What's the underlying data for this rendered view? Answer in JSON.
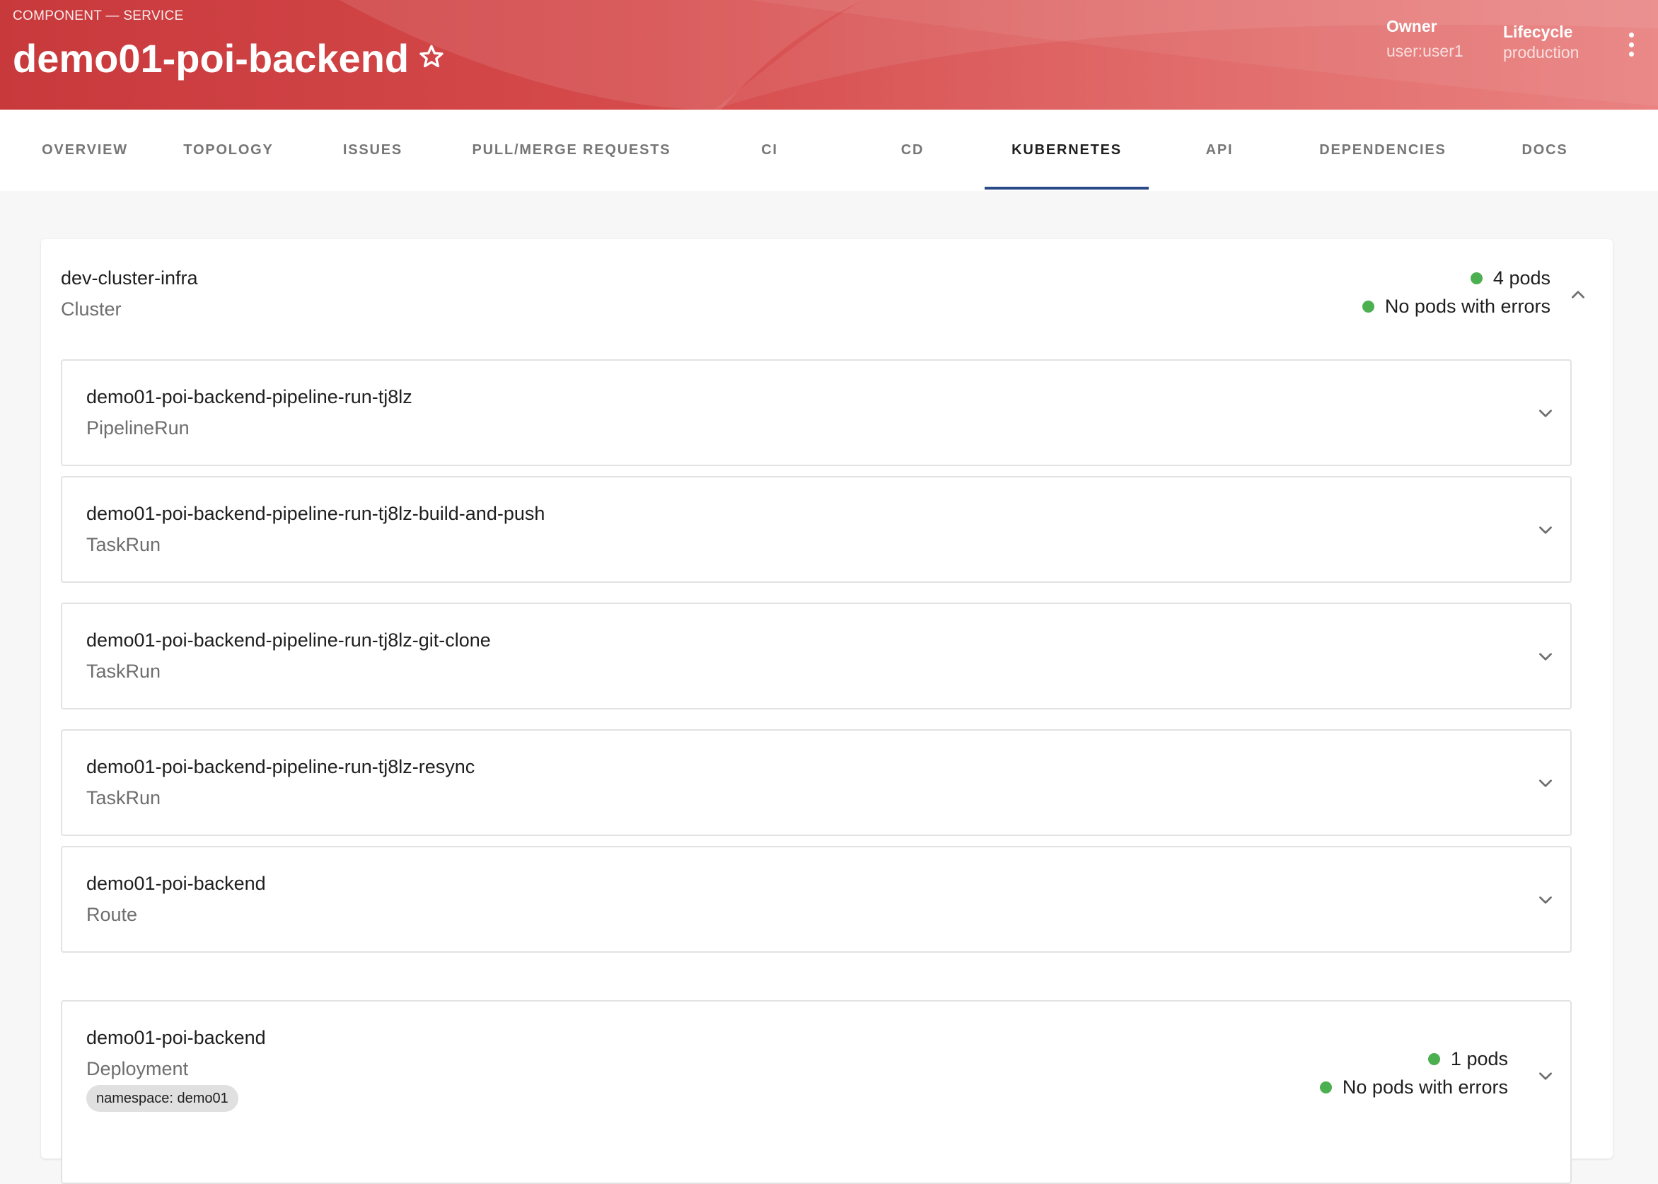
{
  "header": {
    "breadcrumb": "COMPONENT — SERVICE",
    "title": "demo01-poi-backend",
    "owner_label": "Owner",
    "owner_value": "user:user1",
    "lifecycle_label": "Lifecycle",
    "lifecycle_value": "production",
    "favorite_icon": "star-outline",
    "menu_icon": "more-vertical"
  },
  "tabs": [
    {
      "label": "OVERVIEW"
    },
    {
      "label": "TOPOLOGY"
    },
    {
      "label": "ISSUES"
    },
    {
      "label": "PULL/MERGE REQUESTS"
    },
    {
      "label": "CI"
    },
    {
      "label": "CD"
    },
    {
      "label": "KUBERNETES",
      "active": true
    },
    {
      "label": "API"
    },
    {
      "label": "DEPENDENCIES"
    },
    {
      "label": "DOCS"
    }
  ],
  "cluster": {
    "name": "dev-cluster-infra",
    "type": "Cluster",
    "pods": "4 pods",
    "errors": "No pods with errors",
    "expanded": true,
    "resources": [
      {
        "name": "demo01-poi-backend-pipeline-run-tj8lz",
        "kind": "PipelineRun"
      },
      {
        "name": "demo01-poi-backend-pipeline-run-tj8lz-build-and-push",
        "kind": "TaskRun"
      },
      {
        "name": "demo01-poi-backend-pipeline-run-tj8lz-git-clone",
        "kind": "TaskRun"
      },
      {
        "name": "demo01-poi-backend-pipeline-run-tj8lz-resync",
        "kind": "TaskRun"
      },
      {
        "name": "demo01-poi-backend",
        "kind": "Route"
      }
    ],
    "deployment": {
      "name": "demo01-poi-backend",
      "kind": "Deployment",
      "namespace_chip": "namespace: demo01",
      "pods": "1 pods",
      "errors": "No pods with errors"
    }
  },
  "colors": {
    "header_start": "#c8393c",
    "header_end": "#e98281",
    "status_ok": "#4caf50",
    "tab_indicator": "#2a4a88"
  }
}
